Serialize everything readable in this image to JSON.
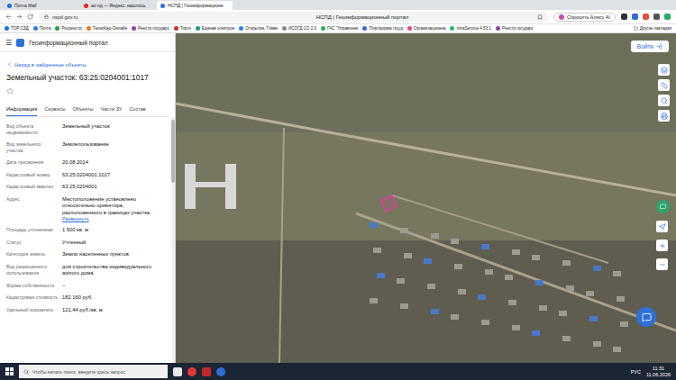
{
  "browser": {
    "tabs": [
      {
        "label": "Почта Mail",
        "selected": false
      },
      {
        "label": "ао пд — Яндекс: нашлось",
        "selected": false
      },
      {
        "label": "НСПД | Геоинформационн",
        "selected": true
      }
    ],
    "url": "nspd.gov.ru",
    "page_title": "НСПД | Геоинформационный портал",
    "alice": "Спросить Алису AI",
    "bookmarks": [
      "TOP СЗД",
      "Почта",
      "Росреестр",
      "ТехноКад-Онлайн",
      "Реестр государс",
      "Торги",
      "Единая электрон",
      "Открытая. Главн",
      "ИСОГД СО 2.0",
      "ГАС \"Управлени",
      "Платформа госуд",
      "Организационна",
      "IntraService 4.53.1",
      "Реестр государс"
    ],
    "other_bookmarks": "Другие закладки"
  },
  "app": {
    "menu": "☰",
    "title": "Геоинформационный портал",
    "login": "Войти"
  },
  "panel": {
    "back": "Назад в найденные объекты",
    "heading": "Земельный участок: 63:25:0204001:1017",
    "favorite": false,
    "tabs": [
      {
        "label": "Информация",
        "selected": true
      },
      {
        "label": "Сервисы",
        "selected": false
      },
      {
        "label": "Объекты",
        "selected": false
      },
      {
        "label": "Части ЗУ",
        "selected": false
      },
      {
        "label": "Состав",
        "selected": false
      }
    ],
    "fields": [
      {
        "label": "Вид объекта недвижимости",
        "value": "Земельный участок",
        "link": ""
      },
      {
        "label": "Вид земельного участка",
        "value": "Землепользование",
        "link": ""
      },
      {
        "label": "Дата присвоения",
        "value": "20.08.2014",
        "link": ""
      },
      {
        "label": "Кадастровый номер",
        "value": "63:25:0204001:1017",
        "link": ""
      },
      {
        "label": "Кадастровый квартал",
        "value": "63:25:0204001",
        "link": ""
      },
      {
        "label": "Адрес",
        "value": "Местоположение установлено относительно ориентира, расположенного в границах участка.",
        "link": "Развернуть"
      },
      {
        "label": "Площадь уточненная",
        "value": "1 500 кв. м",
        "link": ""
      },
      {
        "label": "Статус",
        "value": "Учтенный",
        "link": ""
      },
      {
        "label": "Категория земель",
        "value": "Земли населенных пунктов",
        "link": ""
      },
      {
        "label": "Вид разрешенного использования",
        "value": "для строительства индивидуального жилого дома",
        "link": ""
      },
      {
        "label": "Форма собственности",
        "value": "–",
        "link": ""
      },
      {
        "label": "Кадастровая стоимость",
        "value": "182 160 руб.",
        "link": ""
      },
      {
        "label": "Удельный показатель",
        "value": "121,44 руб./кв. м",
        "link": ""
      }
    ]
  },
  "taskbar": {
    "search": "Чтобы начать поиск, введите здесь запрос",
    "lang": "РУС",
    "time": "11:31",
    "date": "11.06.2026"
  }
}
